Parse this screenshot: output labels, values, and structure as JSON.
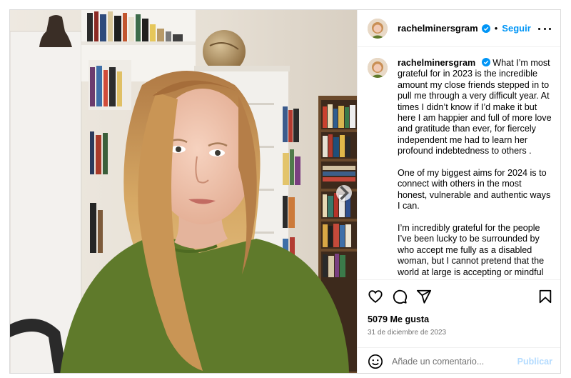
{
  "post": {
    "username": "rachelminersgram",
    "follow_label": "Seguir",
    "separator": "•",
    "verified_icon": "verified-badge-icon",
    "caption_paragraphs": [
      "What I’m most grateful for in 2023 is the incredible amount my close friends stepped in to pull me through a very difficult year. At times I didn’t know if I’d make it but here I am happier and full of more love and gratitude than ever, for fiercely independent me had to learn her profound indebtedness to others .",
      "One of my biggest aims for 2024 is to connect with others in the most honest, vulnerable and authentic ways I can.",
      "I’m incredibly grateful for the people I’ve been lucky to be surrounded by who accept me fully as a disabled woman, but I cannot pretend that the world at large is accepting or mindful"
    ],
    "likes": "5079 Me gusta",
    "date": "31 de diciembre de 2023",
    "comment_placeholder": "Añade un comentario...",
    "publish_label": "Publicar"
  },
  "icons": {
    "like": "heart-icon",
    "comment": "comment-icon",
    "share": "share-icon",
    "save": "bookmark-icon",
    "emoji": "emoji-icon",
    "more": "more-options-icon",
    "next": "chevron-right-icon"
  },
  "colors": {
    "accent": "#0095f6",
    "publish_disabled": "#b3dbff",
    "secondary_text": "#737373",
    "border": "#dbdbdb"
  }
}
